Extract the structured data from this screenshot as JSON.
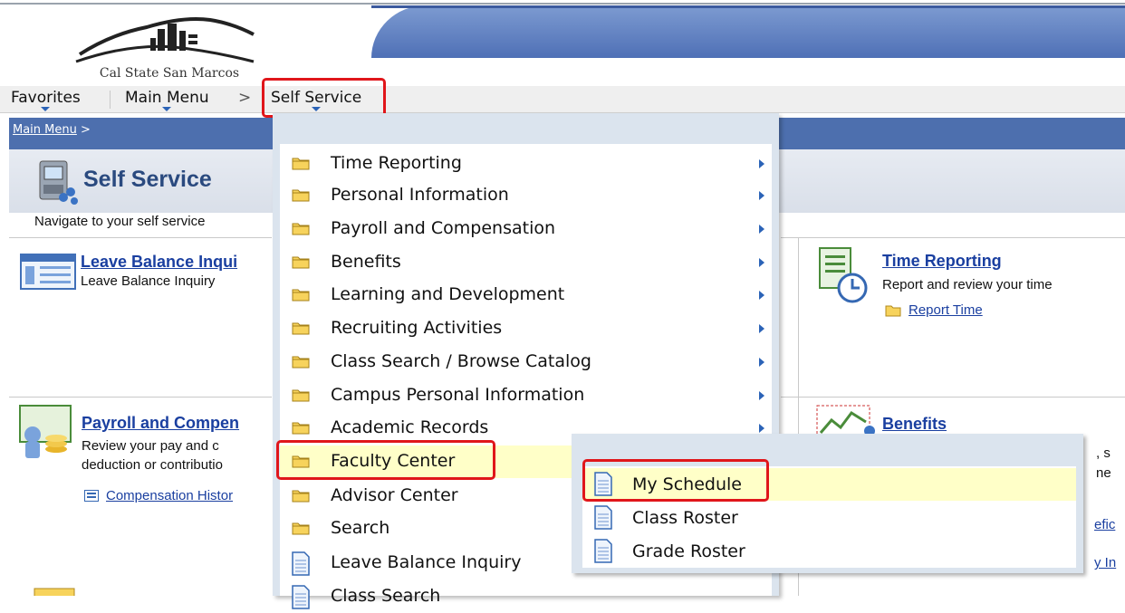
{
  "header": {
    "logo_text": "Cal State San Marcos"
  },
  "nav": {
    "favorites": "Favorites",
    "main_menu": "Main Menu",
    "separator": ">",
    "self_service": "Self Service"
  },
  "breadcrumb": {
    "main_menu_link": "Main Menu",
    "separator": ">"
  },
  "page": {
    "title": "Self Service",
    "instructions": "Navigate to your self service"
  },
  "tiles": {
    "leave": {
      "title": "Leave Balance Inqui",
      "desc": "Leave Balance Inquiry"
    },
    "time": {
      "title": "Time Reporting",
      "desc": "Report and review your time",
      "link": "Report Time"
    },
    "payroll": {
      "title": "Payroll and Compen",
      "desc1": "Review your pay and c",
      "desc2": "deduction or contributio",
      "link": "Compensation Histor"
    },
    "benefits": {
      "title": "Benefits",
      "frag1": ", s",
      "frag2": "ne",
      "frag3": "efic",
      "frag4": "y In"
    }
  },
  "menu": {
    "items": [
      {
        "label": "Time Reporting",
        "icon": "folder-icon",
        "submenu": true
      },
      {
        "label": "Personal Information",
        "icon": "folder-icon",
        "submenu": true
      },
      {
        "label": "Payroll and Compensation",
        "icon": "folder-icon",
        "submenu": true
      },
      {
        "label": "Benefits",
        "icon": "folder-icon",
        "submenu": true
      },
      {
        "label": "Learning and Development",
        "icon": "folder-icon",
        "submenu": true
      },
      {
        "label": "Recruiting Activities",
        "icon": "folder-icon",
        "submenu": true
      },
      {
        "label": "Class Search / Browse Catalog",
        "icon": "folder-icon",
        "submenu": true
      },
      {
        "label": "Campus Personal Information",
        "icon": "folder-icon",
        "submenu": true
      },
      {
        "label": "Academic Records",
        "icon": "folder-icon",
        "submenu": true
      },
      {
        "label": "Faculty Center",
        "icon": "folder-icon",
        "submenu": true
      },
      {
        "label": "Advisor Center",
        "icon": "folder-icon",
        "submenu": false
      },
      {
        "label": "Search",
        "icon": "folder-icon",
        "submenu": false
      },
      {
        "label": "Leave Balance Inquiry",
        "icon": "document-icon",
        "submenu": false
      },
      {
        "label": "Class Search",
        "icon": "document-icon",
        "submenu": false
      }
    ]
  },
  "submenu": {
    "items": [
      {
        "label": "My Schedule",
        "icon": "document-icon",
        "highlighted": true
      },
      {
        "label": "Class Roster",
        "icon": "document-icon",
        "highlighted": false
      },
      {
        "label": "Grade Roster",
        "icon": "document-icon",
        "highlighted": false
      }
    ]
  },
  "colors": {
    "highlight": "#ffffc8",
    "accent": "#2b63b7",
    "annotation": "#e0161b",
    "crumb_bar": "#4d6fae"
  }
}
